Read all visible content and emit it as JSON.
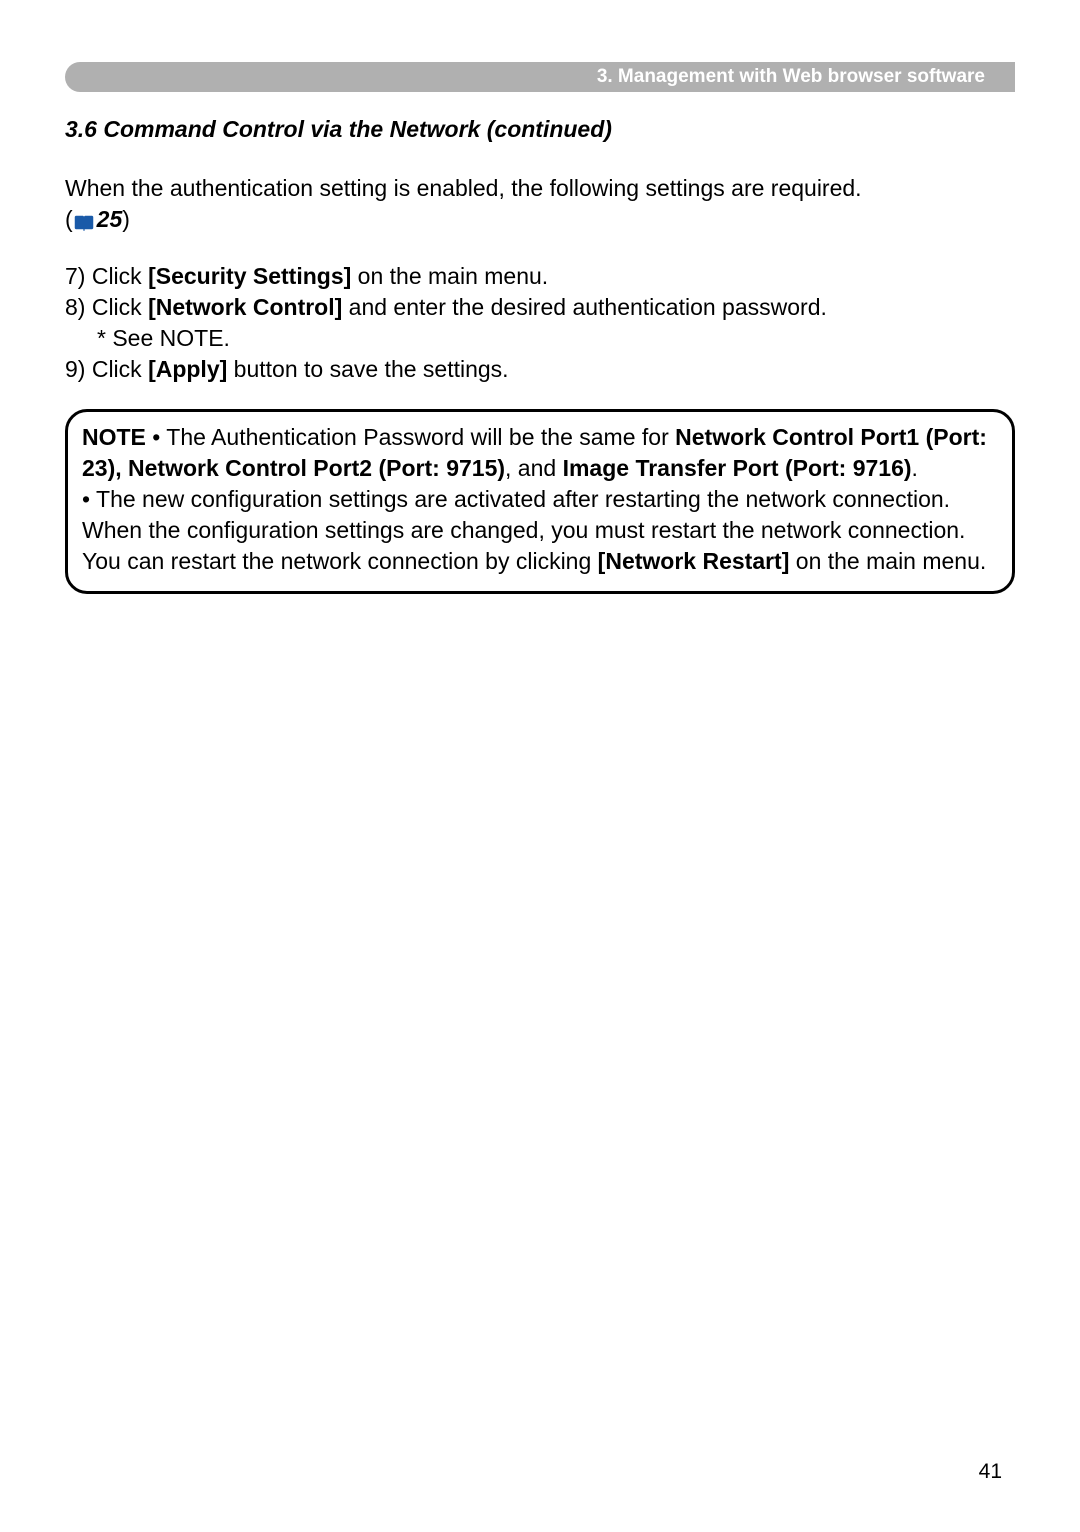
{
  "header": {
    "chapter": "3. Management with Web browser software"
  },
  "section": {
    "title": "3.6 Command Control via the Network (continued)"
  },
  "intro": {
    "text": "When the authentication setting is enabled, the following settings are required.",
    "ref_open": "(",
    "ref_num": "25",
    "ref_close": ")"
  },
  "steps": {
    "s7_prefix": "7) Click ",
    "s7_bold": "[Security Settings]",
    "s7_suffix": " on the main menu.",
    "s8_prefix": "8) Click ",
    "s8_bold": "[Network Control]",
    "s8_suffix": " and enter the desired authentication password.",
    "s8_note": "* See NOTE.",
    "s9_prefix": "9) Click ",
    "s9_bold": "[Apply]",
    "s9_suffix": " button to save the settings."
  },
  "note": {
    "label": "NOTE",
    "p1_a": "  • The Authentication Password will be the same for ",
    "p1_b": "Network Control Port1 (Port: 23), Network Control Port2 (Port: 9715)",
    "p1_c": ", and ",
    "p1_d": "Image Transfer Port (Port: 9716)",
    "p1_e": ".",
    "p2_a": "• The new configuration settings are activated after restarting the network connection. When the configuration settings are changed, you must restart the network connection. You can restart the network connection by clicking ",
    "p2_b": "[Network Restart]",
    "p2_c": " on the main menu."
  },
  "pageNumber": "41"
}
